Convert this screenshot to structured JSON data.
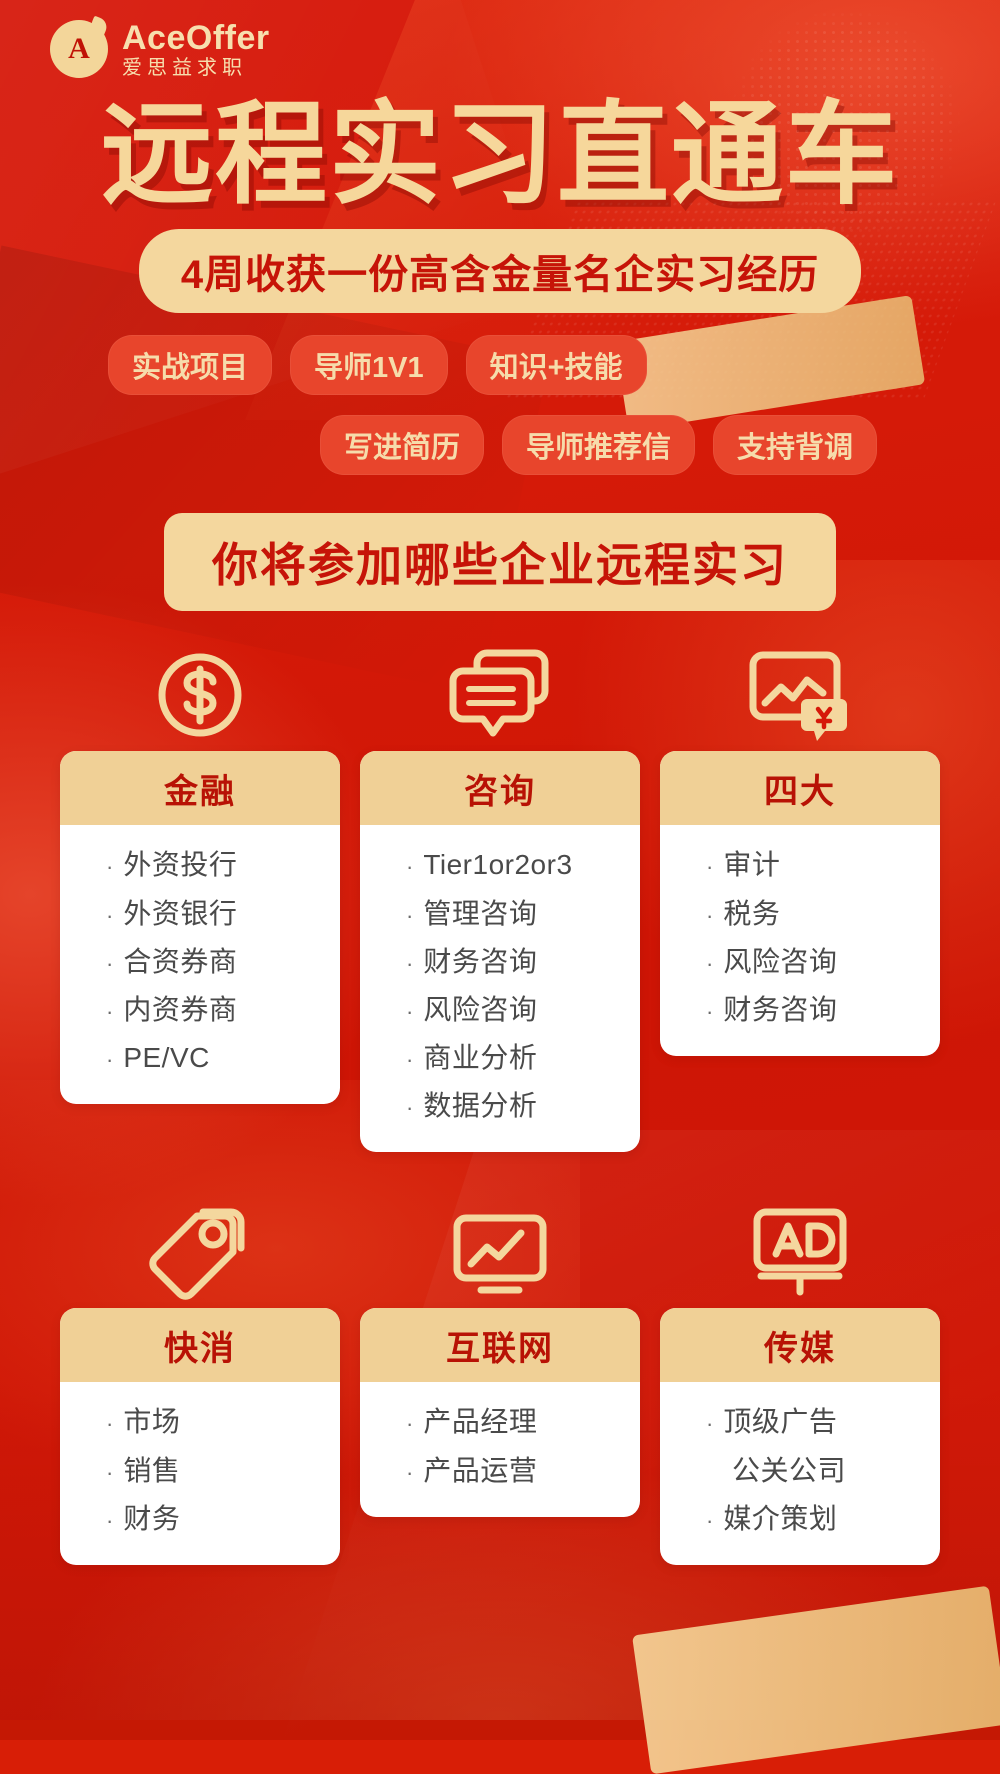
{
  "brand": {
    "mark_letter": "A",
    "name_en": "AceOffer",
    "name_cn": "爱思益求职"
  },
  "hero": {
    "title": "远程实习直通车",
    "subtitle_pill": "4周收获一份高含金量名企实习经历",
    "tags_row1": [
      "实战项目",
      "导师1V1",
      "知识+技能"
    ],
    "tags_row2": [
      "写进简历",
      "导师推荐信",
      "支持背调"
    ]
  },
  "section": {
    "banner": "你将参加哪些企业远程实习"
  },
  "colors": {
    "bg_red": "#D6180A",
    "gold": "#F4D79E",
    "gold_head": "#F0D096",
    "title_red": "#B81205",
    "tag_bg": "#E8452C",
    "item_text": "#4A4A4A"
  },
  "cards": [
    {
      "icon": "dollar-coin-icon",
      "title": "金融",
      "items": [
        {
          "text": "外资投行",
          "bullet": true
        },
        {
          "text": "外资银行",
          "bullet": true
        },
        {
          "text": "合资券商",
          "bullet": true
        },
        {
          "text": "内资券商",
          "bullet": true
        },
        {
          "text": "PE/VC",
          "bullet": true
        }
      ]
    },
    {
      "icon": "chat-bubble-icon",
      "title": "咨询",
      "items": [
        {
          "text": "Tier1or2or3",
          "bullet": true
        },
        {
          "text": "管理咨询",
          "bullet": true
        },
        {
          "text": "财务咨询",
          "bullet": true
        },
        {
          "text": "风险咨询",
          "bullet": true
        },
        {
          "text": "商业分析",
          "bullet": true
        },
        {
          "text": "数据分析",
          "bullet": true
        }
      ]
    },
    {
      "icon": "chart-yen-icon",
      "title": "四大",
      "items": [
        {
          "text": "审计",
          "bullet": true
        },
        {
          "text": "税务",
          "bullet": true
        },
        {
          "text": "风险咨询",
          "bullet": true
        },
        {
          "text": "财务咨询",
          "bullet": true
        }
      ]
    },
    {
      "icon": "price-tag-icon",
      "title": "快消",
      "items": [
        {
          "text": "市场",
          "bullet": true
        },
        {
          "text": "销售",
          "bullet": true
        },
        {
          "text": "财务",
          "bullet": true
        }
      ]
    },
    {
      "icon": "line-chart-monitor-icon",
      "title": "互联网",
      "items": [
        {
          "text": "产品经理",
          "bullet": true
        },
        {
          "text": "产品运营",
          "bullet": true
        }
      ]
    },
    {
      "icon": "ad-board-icon",
      "title": "传媒",
      "items": [
        {
          "text": "顶级广告",
          "bullet": true
        },
        {
          "text": "公关公司",
          "bullet": false
        },
        {
          "text": "媒介策划",
          "bullet": true
        }
      ]
    }
  ]
}
